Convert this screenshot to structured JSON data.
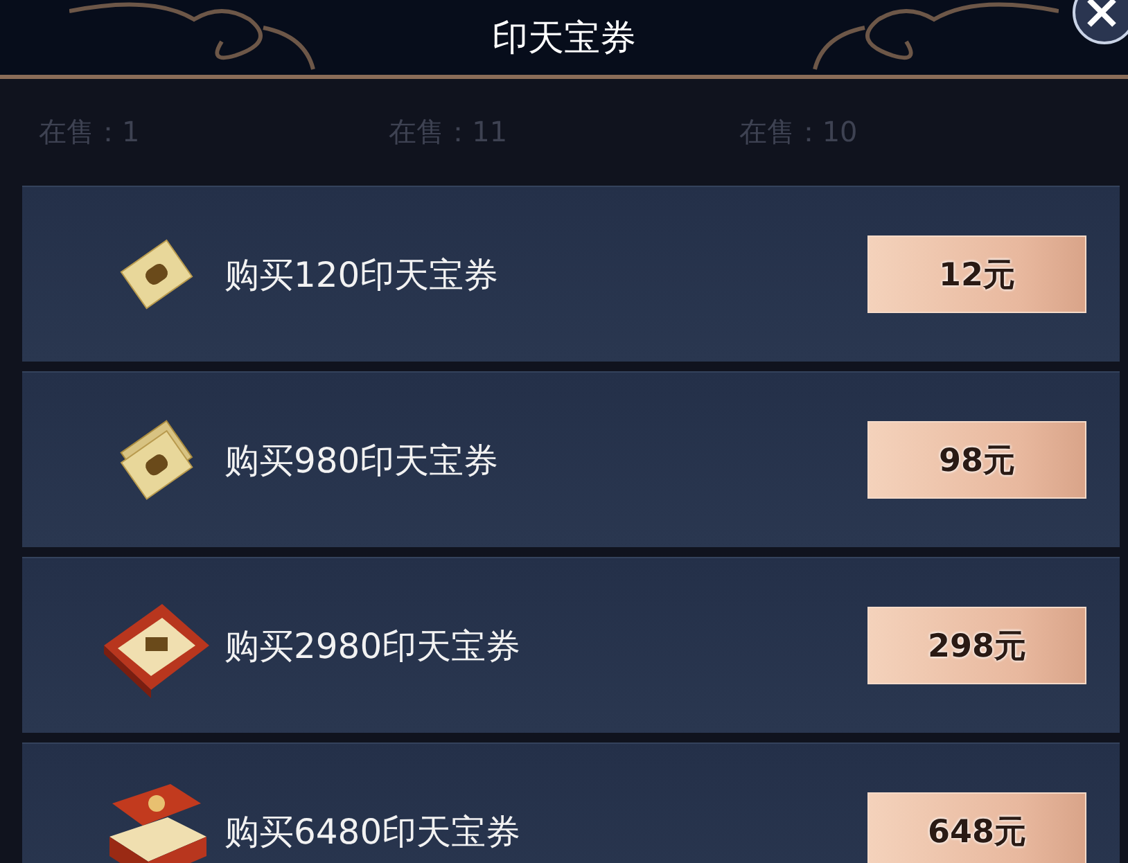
{
  "header": {
    "title": "印天宝券"
  },
  "stock_counts": [
    "在售：1",
    "在售：11",
    "在售：10"
  ],
  "offers": [
    {
      "kind": "ticket",
      "label": "购买120印天宝券",
      "price": "12元"
    },
    {
      "kind": "ticket-stack",
      "label": "购买980印天宝券",
      "price": "98元"
    },
    {
      "kind": "box",
      "label": "购买2980印天宝券",
      "price": "298元"
    },
    {
      "kind": "chest",
      "label": "购买6480印天宝券",
      "price": "648元"
    }
  ]
}
